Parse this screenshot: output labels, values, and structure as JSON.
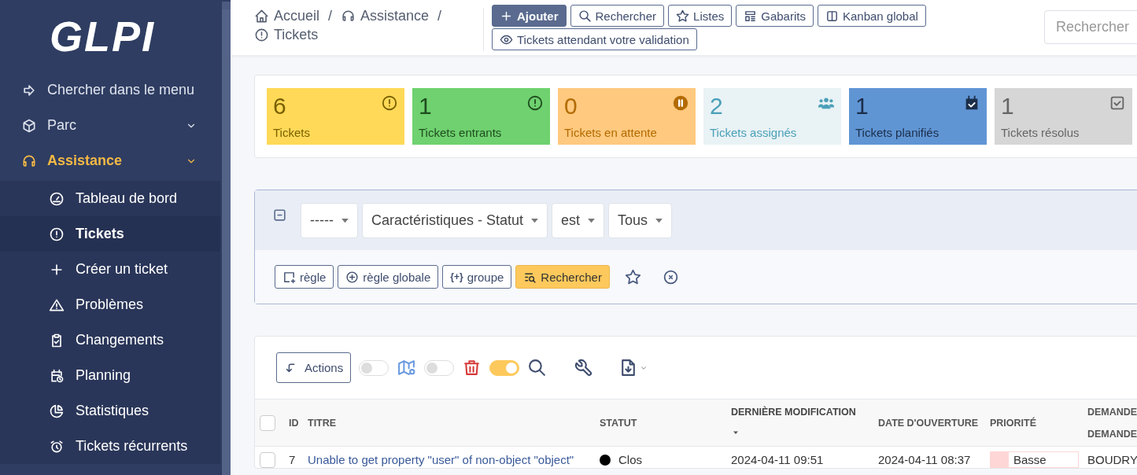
{
  "sidebar": {
    "logo": "GLPI",
    "menu": [
      {
        "label": "Chercher dans le menu",
        "kind": "search",
        "selected": false
      },
      {
        "label": "Parc",
        "kind": "section",
        "selected": false
      },
      {
        "label": "Assistance",
        "kind": "section",
        "selected": true,
        "children": [
          {
            "label": "Tableau de bord",
            "selected": false
          },
          {
            "label": "Tickets",
            "selected": true
          },
          {
            "label": "Créer un ticket",
            "selected": false
          },
          {
            "label": "Problèmes",
            "selected": false
          },
          {
            "label": "Changements",
            "selected": false
          },
          {
            "label": "Planning",
            "selected": false
          },
          {
            "label": "Statistiques",
            "selected": false
          },
          {
            "label": "Tickets récurrents",
            "selected": false
          }
        ]
      }
    ]
  },
  "header": {
    "breadcrumb": [
      {
        "label": "Accueil"
      },
      {
        "label": "Assistance"
      },
      {
        "label": "Tickets"
      }
    ],
    "separator": "/",
    "buttons": [
      {
        "label": "Ajouter",
        "kind": "primary"
      },
      {
        "label": "Rechercher",
        "kind": "outline"
      },
      {
        "label": "Listes",
        "kind": "outline"
      },
      {
        "label": "Gabarits",
        "kind": "outline"
      },
      {
        "label": "Kanban global",
        "kind": "outline"
      },
      {
        "label": "Tickets attendant votre validation",
        "kind": "outline"
      }
    ],
    "search": {
      "placeholder": "Rechercher"
    }
  },
  "stat_cards": [
    {
      "value": "6",
      "label": "Tickets",
      "kind": "total",
      "color": "#ffd957"
    },
    {
      "value": "1",
      "label": "Tickets entrants",
      "kind": "new",
      "color": "#6fd16f"
    },
    {
      "value": "0",
      "label": "Tickets en attente",
      "kind": "waiting",
      "color": "#ffc97f"
    },
    {
      "value": "2",
      "label": "Tickets assignés",
      "kind": "assigned",
      "color": "#e9f2f5"
    },
    {
      "value": "1",
      "label": "Tickets planifiés",
      "kind": "planned",
      "color": "#6095d4"
    },
    {
      "value": "1",
      "label": "Tickets résolus",
      "kind": "solved",
      "color": "#d6d6d6"
    }
  ],
  "filter": {
    "expanded": true,
    "criteria": [
      {
        "value": "-----"
      },
      {
        "value": "Caractéristiques - Statut"
      },
      {
        "value": "est"
      },
      {
        "value": "Tous"
      }
    ],
    "buttons": [
      {
        "label": "règle",
        "kind": "outline"
      },
      {
        "label": "règle globale",
        "kind": "outline"
      },
      {
        "label": "groupe",
        "kind": "outline",
        "glyph": "{+}"
      },
      {
        "label": "Rechercher",
        "kind": "primary"
      }
    ]
  },
  "toolbar": {
    "actions": "Actions",
    "toggles": [
      {
        "on": false
      },
      {
        "on": false
      },
      {
        "on": true
      }
    ]
  },
  "table": {
    "header_checked": false,
    "columns": [
      {
        "label": "ID",
        "sorted": false
      },
      {
        "label": "TITRE",
        "sorted": false
      },
      {
        "label": "STATUT",
        "sorted": false
      },
      {
        "label": "DERNIÈRE MODIFICATION",
        "sorted": true
      },
      {
        "label": "DATE D'OUVERTURE",
        "sorted": false
      },
      {
        "label": "PRIORITÉ",
        "sorted": false
      },
      {
        "label": "DEMANDE\nDEMANDE",
        "sorted": false
      }
    ],
    "rows": [
      {
        "checked": false,
        "id": "7",
        "title": "Unable to get property \"user\" of non-object \"object\"",
        "status": {
          "label": "Clos",
          "color": "#000000"
        },
        "modified": "2024-04-11 09:51",
        "opened": "2024-04-11 08:37",
        "priority": {
          "label": "Basse",
          "color": "#ffd6d6"
        },
        "requester": "BOUDRY"
      }
    ]
  }
}
